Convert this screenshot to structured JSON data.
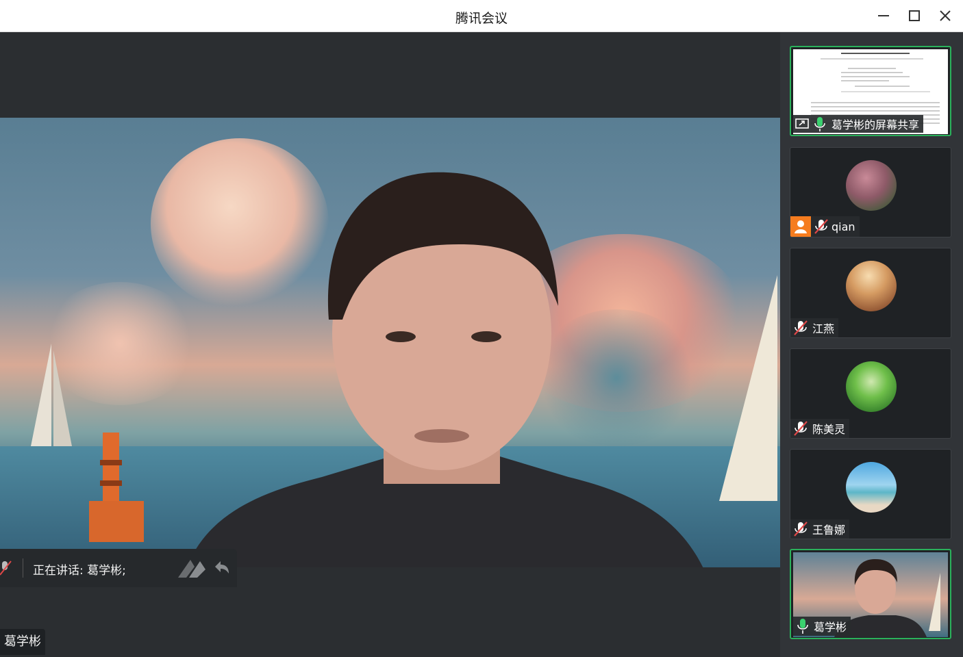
{
  "window": {
    "title": "腾讯会议"
  },
  "main": {
    "speaking_label": "正在讲话: 葛学彬;",
    "presenter_name": "葛学彬"
  },
  "participants": [
    {
      "name": "葛学彬的屏幕共享",
      "type": "screen-share",
      "mic": "on"
    },
    {
      "name": "qian",
      "type": "avatar",
      "mic": "off",
      "host_badge": true
    },
    {
      "name": "江燕",
      "type": "avatar",
      "mic": "off"
    },
    {
      "name": "陈美灵",
      "type": "avatar",
      "mic": "off"
    },
    {
      "name": "王鲁娜",
      "type": "avatar",
      "mic": "off"
    },
    {
      "name": "葛学彬",
      "type": "video",
      "mic": "on"
    }
  ],
  "colors": {
    "active_border": "#2bb15b",
    "host_badge": "#f57c1f",
    "mic_on": "#3bd16f",
    "mic_off": "#e04848"
  }
}
